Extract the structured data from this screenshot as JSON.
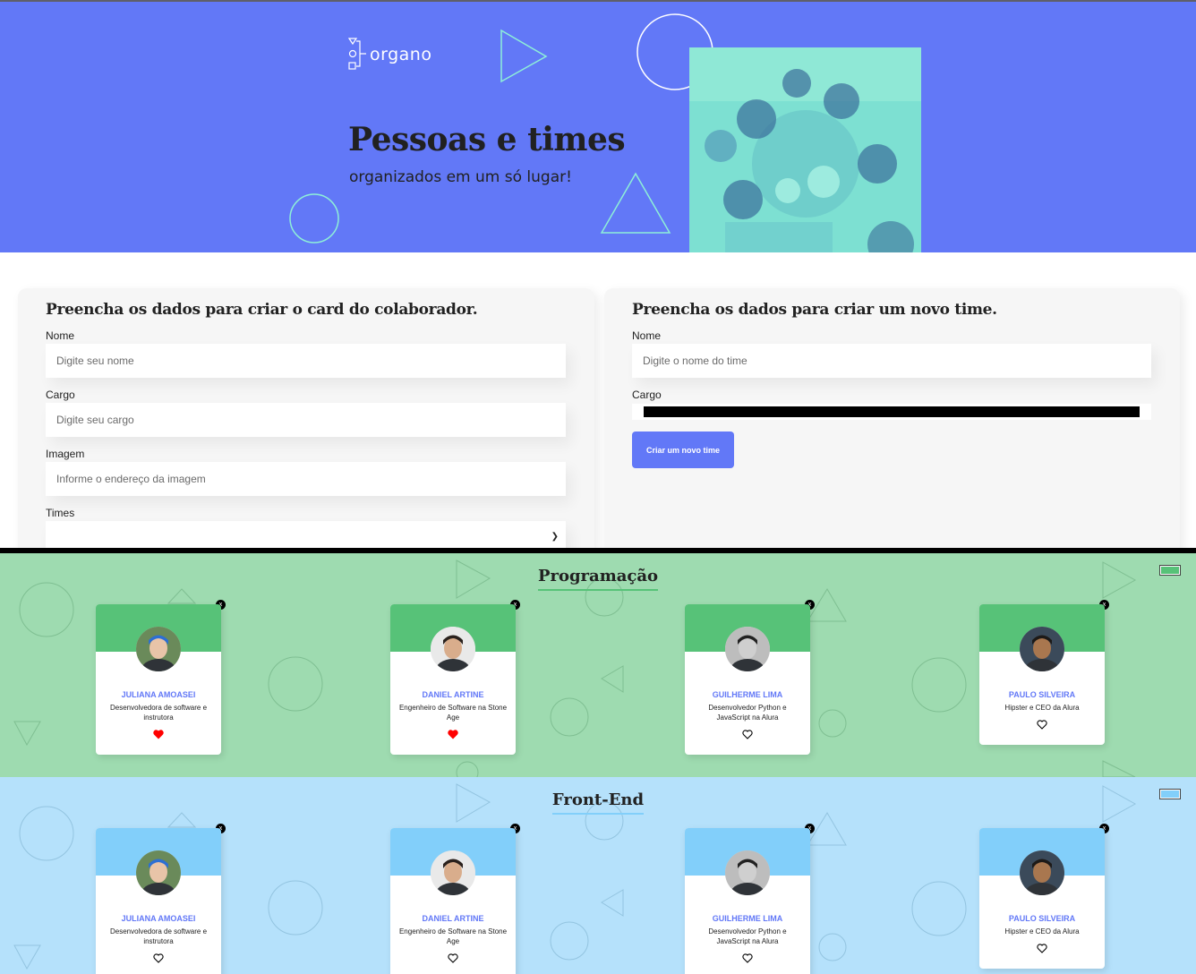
{
  "header": {
    "logo_text": "organo",
    "title": "Pessoas e times",
    "subtitle": "organizados em um só lugar!"
  },
  "collaborator_form": {
    "title": "Preencha os dados para criar o card do colaborador.",
    "name_label": "Nome",
    "name_placeholder": "Digite seu nome",
    "role_label": "Cargo",
    "role_placeholder": "Digite seu cargo",
    "image_label": "Imagem",
    "image_placeholder": "Informe o endereço da imagem",
    "team_label": "Times",
    "team_value": ""
  },
  "team_form": {
    "title": "Preencha os dados para criar um novo time.",
    "name_label": "Nome",
    "name_placeholder": "Digite o nome do time",
    "color_label": "Cargo",
    "color_value": "#000000",
    "submit_label": "Criar um novo time"
  },
  "teams": [
    {
      "name": "Programação",
      "primary_color": "#57c278",
      "secondary_color": "#d9f7e9",
      "members": [
        {
          "name": "JULIANA AMOASEI",
          "role": "Desenvolvedora de software e instrutora",
          "favorite": true
        },
        {
          "name": "DANIEL ARTINE",
          "role": "Engenheiro de Software na Stone Age",
          "favorite": true
        },
        {
          "name": "GUILHERME LIMA",
          "role": "Desenvolvedor Python e JavaScript na Alura",
          "favorite": false
        },
        {
          "name": "PAULO SILVEIRA",
          "role": "Hipster e CEO da Alura",
          "favorite": false
        }
      ]
    },
    {
      "name": "Front-End",
      "primary_color": "#82cffa",
      "secondary_color": "#e8f8ff",
      "members": [
        {
          "name": "JULIANA AMOASEI",
          "role": "Desenvolvedora de software e instrutora",
          "favorite": false
        },
        {
          "name": "DANIEL ARTINE",
          "role": "Engenheiro de Software na Stone Age",
          "favorite": false
        },
        {
          "name": "GUILHERME LIMA",
          "role": "Desenvolvedor Python e JavaScript na Alura",
          "favorite": false
        },
        {
          "name": "PAULO SILVEIRA",
          "role": "Hipster e CEO da Alura",
          "favorite": false
        }
      ]
    }
  ],
  "icons": {
    "delete": "x",
    "favorite_filled": "heart-filled-icon",
    "favorite_outline": "heart-outline-icon"
  }
}
